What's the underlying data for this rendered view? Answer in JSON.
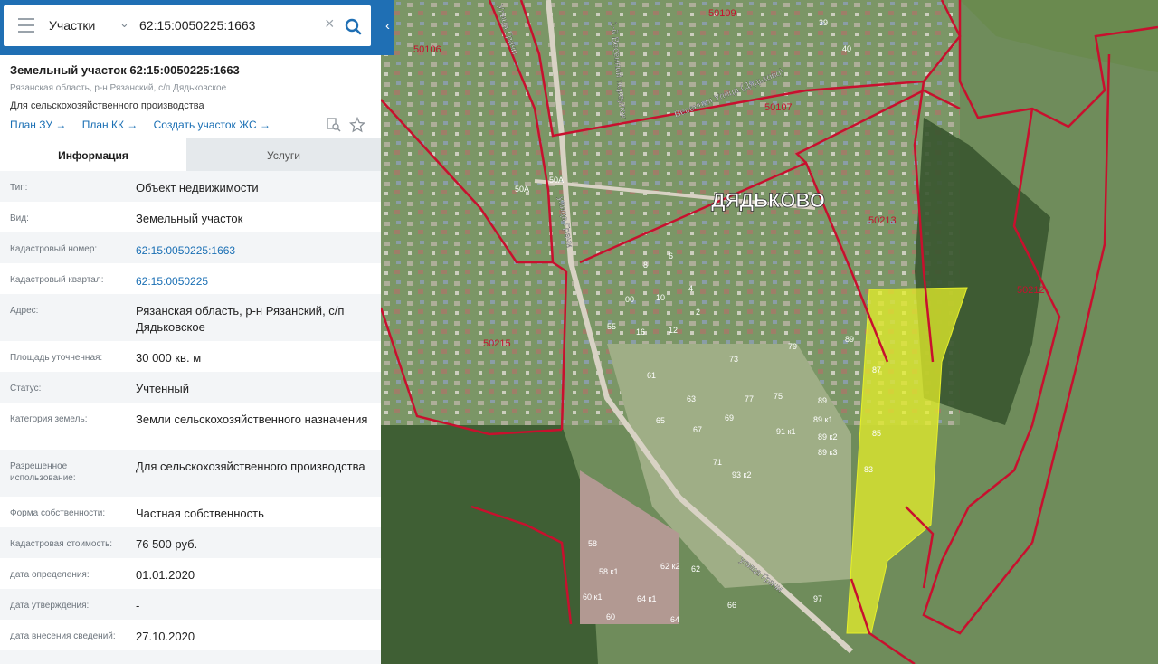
{
  "search": {
    "category": "Участки",
    "value": "62:15:0050225:1663"
  },
  "parcel": {
    "title": "Земельный участок 62:15:0050225:1663",
    "address": "Рязанская область, р-н Рязанский, с/п Дядьковское",
    "purpose": "Для сельскохозяйственного производства"
  },
  "links": [
    "План ЗУ →",
    "План КК →",
    "Создать участок ЖС →"
  ],
  "tabs": [
    "Информация",
    "Услуги"
  ],
  "info": [
    {
      "label": "Тип:",
      "value": "Объект недвижимости"
    },
    {
      "label": "Вид:",
      "value": "Земельный участок"
    },
    {
      "label": "Кадастровый номер:",
      "value": "62:15:0050225:1663"
    },
    {
      "label": "Кадастровый квартал:",
      "value": "62:15:0050225"
    },
    {
      "label": "Адрес:",
      "value": "Рязанская область, р-н Рязанский, с/п Дядьковское"
    },
    {
      "label": "Площадь уточненная:",
      "value": "30 000 кв. м"
    },
    {
      "label": "Статус:",
      "value": "Учтенный"
    },
    {
      "label": "Категория земель:",
      "value": "Земли сельскохозяйственного назначения"
    },
    {
      "label": "Разрешенное использование:",
      "value": "Для сельскохозяйственного производства"
    },
    {
      "label": "Форма собственности:",
      "value": "Частная собственность"
    },
    {
      "label": "Кадастровая стоимость:",
      "value": "76 500 руб."
    },
    {
      "label": "дата определения:",
      "value": "01.01.2020"
    },
    {
      "label": "дата утверждения:",
      "value": "-"
    },
    {
      "label": "дата внесения сведений:",
      "value": "27.10.2020"
    },
    {
      "label": "",
      "value": ""
    }
  ],
  "map": {
    "village": "ДЯДЬКОВО",
    "quarters": [
      "50106",
      "50109",
      "50107",
      "50213",
      "50212",
      "50215"
    ],
    "streets": [
      "Улица Грачи",
      "1-й Весенний переулок",
      "Весенняя Улица (Дядьково)",
      "улица Грачи",
      "улица Грачи"
    ],
    "house_numbers": [
      "39",
      "40",
      "50А",
      "50А",
      "8",
      "6",
      "4",
      "2",
      "00",
      "10",
      "55",
      "16",
      "12",
      "79",
      "89",
      "73",
      "87",
      "61",
      "63",
      "77",
      "75",
      "89",
      "65",
      "69",
      "67",
      "91 к1",
      "89 к1",
      "89 к2",
      "85",
      "89 к3",
      "71",
      "93 к2",
      "83",
      "58",
      "58 к1",
      "62 к2",
      "62",
      "60 к1",
      "64 к1",
      "66",
      "60",
      "64",
      "97"
    ],
    "colors": {
      "boundary": "#c8102e",
      "parcel_fill": "#e6ef2a",
      "accent": "#1f6fb4"
    }
  }
}
